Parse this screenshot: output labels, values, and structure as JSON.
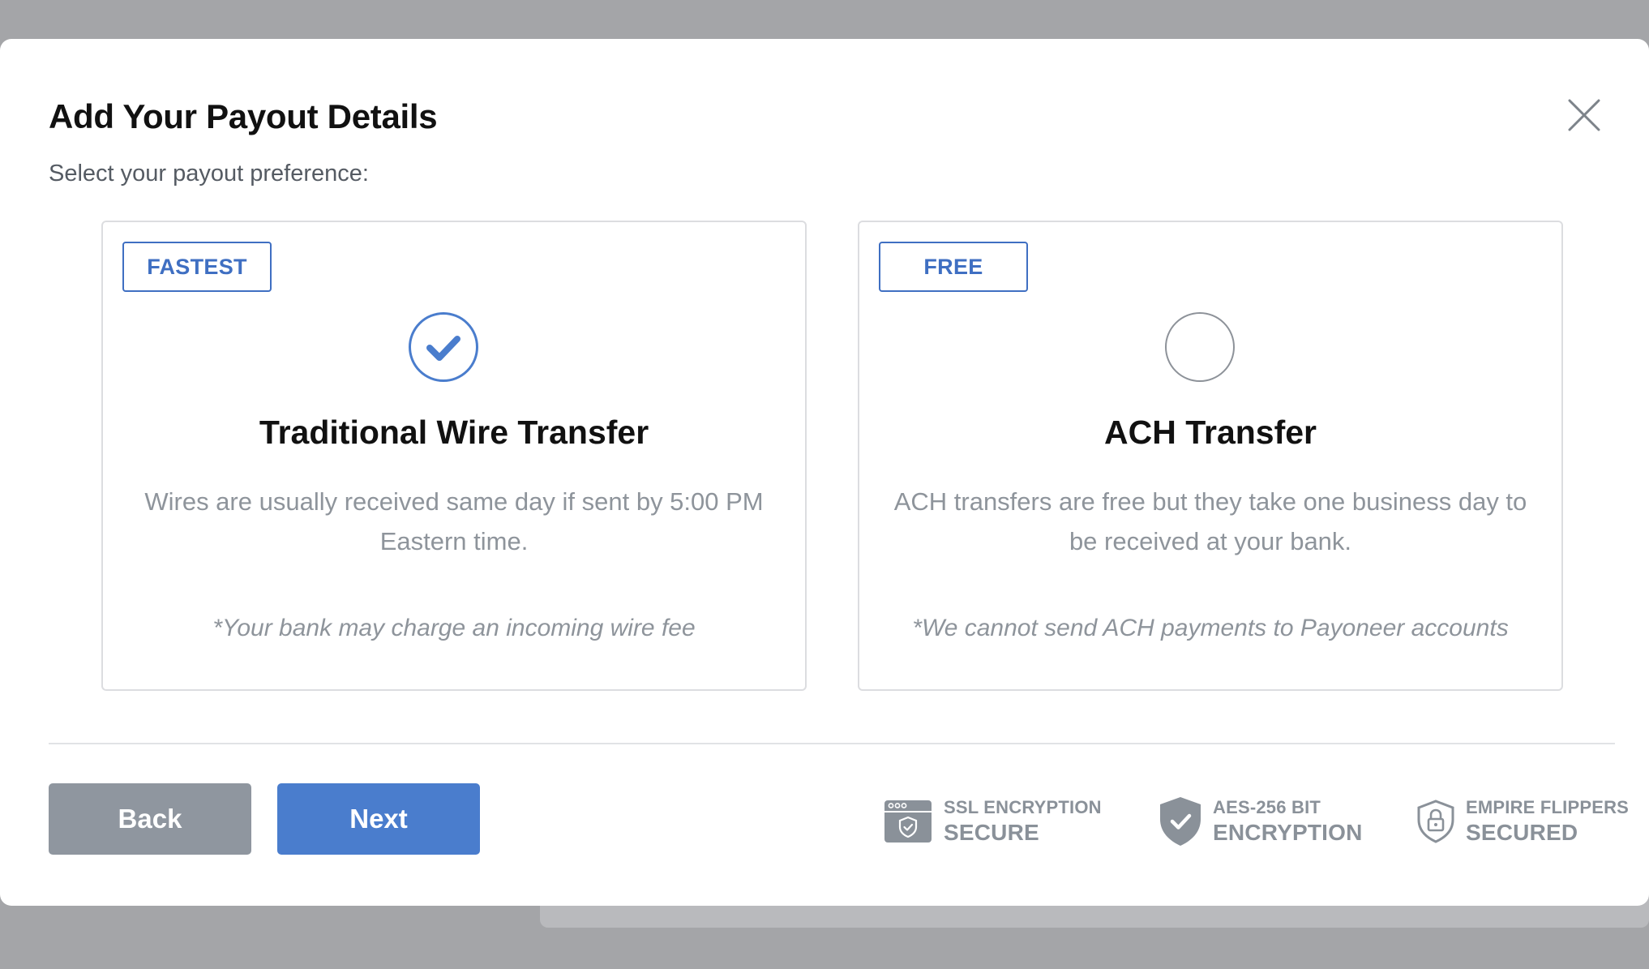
{
  "modal": {
    "title": "Add Your Payout Details",
    "subtitle": "Select your payout preference:"
  },
  "options": [
    {
      "badge": "FASTEST",
      "title": "Traditional Wire Transfer",
      "description": "Wires are usually received same day if sent by 5:00 PM Eastern time.",
      "note": "*Your bank may charge an incoming wire fee",
      "selected": true
    },
    {
      "badge": "FREE",
      "title": "ACH Transfer",
      "description": "ACH transfers are free but they take one business day to be received at your bank.",
      "note": "*We cannot send ACH payments to Payoneer accounts",
      "selected": false
    }
  ],
  "footer": {
    "back_label": "Back",
    "next_label": "Next"
  },
  "security": [
    {
      "icon": "browser-shield-icon",
      "line1": "SSL ENCRYPTION",
      "line2": "SECURE"
    },
    {
      "icon": "shield-check-icon",
      "line1": "AES-256 BIT",
      "line2": "ENCRYPTION"
    },
    {
      "icon": "shield-lock-icon",
      "line1": "EMPIRE FLIPPERS",
      "line2": "SECURED"
    }
  ],
  "colors": {
    "accent": "#4a7dcd",
    "badge": "#3f6fc2",
    "back_button": "#8f969f",
    "muted_text": "#8e949b"
  }
}
